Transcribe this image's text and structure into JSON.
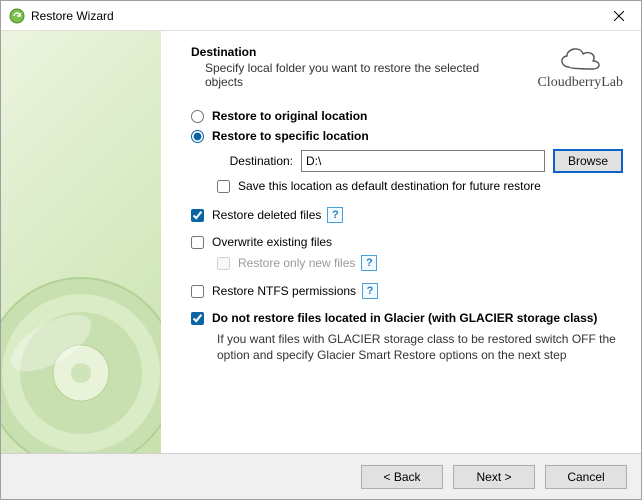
{
  "window": {
    "title": "Restore Wizard"
  },
  "brand": {
    "name": "CloudberryLab"
  },
  "header": {
    "title": "Destination",
    "subtitle": "Specify local folder you want to restore the selected objects"
  },
  "options": {
    "radio_original": "Restore to original location",
    "radio_specific": "Restore to specific location",
    "selected_radio": "specific",
    "destination_label": "Destination:",
    "destination_value": "D:\\",
    "browse_label": "Browse",
    "save_default": {
      "label": "Save this location as default destination for future restore",
      "checked": false
    },
    "restore_deleted": {
      "label": "Restore deleted files",
      "checked": true
    },
    "overwrite": {
      "label": "Overwrite existing files",
      "checked": false
    },
    "restore_only_new": {
      "label": "Restore only new files",
      "checked": false,
      "enabled": false
    },
    "restore_ntfs": {
      "label": "Restore NTFS permissions",
      "checked": false
    },
    "glacier_skip": {
      "label": "Do not restore files located in Glacier (with GLACIER storage class)",
      "checked": true,
      "note": "If you want files with GLACIER storage class to be restored switch OFF the option and specify Glacier Smart Restore options on the next step"
    }
  },
  "footer": {
    "back": "< Back",
    "next": "Next >",
    "cancel": "Cancel"
  }
}
